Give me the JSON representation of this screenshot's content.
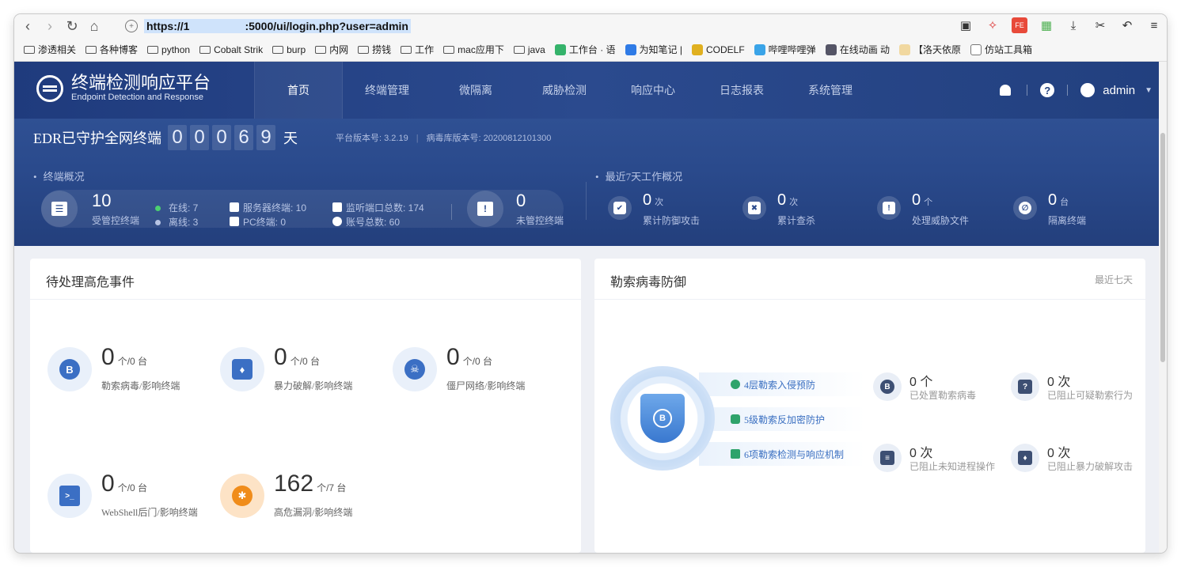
{
  "browser": {
    "url": "https://1          :5000/ui/login.php?user=admin",
    "bookmarks": [
      "渗透相关",
      "各种博客",
      "python",
      "Cobalt Strik",
      "burp",
      "内网",
      "捞钱",
      "工作",
      "mac应用下",
      "java",
      "工作台 · 语",
      "为知笔记 |",
      "CODELF",
      "哔哩哔哩弹",
      "在线动画 动",
      "【洛天依原",
      "仿站工具箱"
    ]
  },
  "app": {
    "title": "终端检测响应平台",
    "subtitle": "Endpoint Detection and Response",
    "nav": [
      "首页",
      "终端管理",
      "微隔离",
      "威胁检测",
      "响应中心",
      "日志报表",
      "系统管理"
    ],
    "user": "admin"
  },
  "overview": {
    "days_title": "EDR已守护全网终端",
    "digits": [
      "0",
      "0",
      "0",
      "6",
      "9"
    ],
    "days_unit": "天",
    "platform_version": "平台版本号: 3.2.19",
    "virus_version": "病毒库版本号: 20200812101300",
    "endpoint_section": "终端概况",
    "managed_count": "10",
    "managed_label": "受管控终端",
    "online": "在线: 7",
    "offline": "离线: 3",
    "server_endpoints": "服务器终端: 10",
    "pc_endpoints": "PC终端: 0",
    "listen_ports": "监听端口总数: 174",
    "accounts": "账号总数: 60",
    "unmanaged_count": "0",
    "unmanaged_label": "未管控终端",
    "week_section": "最近7天工作概况",
    "week_stats": [
      {
        "num": "0",
        "unit": "次",
        "label": "累计防御攻击"
      },
      {
        "num": "0",
        "unit": "次",
        "label": "累计查杀"
      },
      {
        "num": "0",
        "unit": "个",
        "label": "处理威胁文件"
      },
      {
        "num": "0",
        "unit": "台",
        "label": "隔离终端"
      }
    ]
  },
  "events": {
    "title": "待处理高危事件",
    "items": [
      {
        "num": "0",
        "unit": "个/0 台",
        "label": "勒索病毒/影响终端"
      },
      {
        "num": "0",
        "unit": "个/0 台",
        "label": "暴力破解/影响终端"
      },
      {
        "num": "0",
        "unit": "个/0 台",
        "label": "僵尸网络/影响终端"
      },
      {
        "num": "0",
        "unit": "个/0 台",
        "label": "WebShell后门/影响终端"
      },
      {
        "num": "162",
        "unit": "个/7 台",
        "label": "高危漏洞/影响终端"
      }
    ]
  },
  "ransomware": {
    "title": "勒索病毒防御",
    "range": "最近七天",
    "pills": [
      "4层勒索入侵预防",
      "5级勒索反加密防护",
      "6项勒索检测与响应机制"
    ],
    "stats": [
      {
        "num": "0 个",
        "label": "已处置勒索病毒"
      },
      {
        "num": "0 次",
        "label": "已阻止可疑勒索行为"
      },
      {
        "num": "0 次",
        "label": "已阻止未知进程操作"
      },
      {
        "num": "0 次",
        "label": "已阻止暴力破解攻击"
      }
    ]
  }
}
